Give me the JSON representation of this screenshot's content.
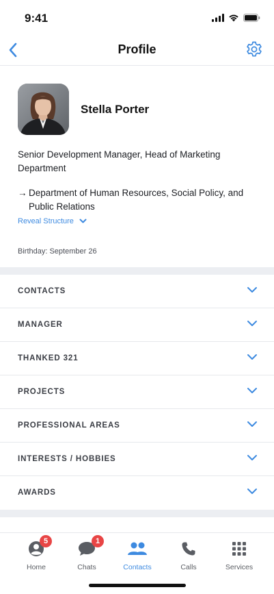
{
  "status_bar": {
    "time": "9:41",
    "icons": [
      "signal-icon",
      "wifi-icon",
      "battery-icon"
    ]
  },
  "nav": {
    "title": "Profile",
    "back_icon": "chevron-left-icon",
    "settings_icon": "gear-icon"
  },
  "profile": {
    "name": "Stella Porter",
    "position": "Senior Development Manager, Head of Marketing Department",
    "department_arrow": "→",
    "department": "Department of Human Resources, Social Policy, and Public Relations",
    "reveal_label": "Reveal Structure",
    "birthday": "Birthday: September 26"
  },
  "sections": [
    {
      "label": "CONTACTS"
    },
    {
      "label": "MANAGER"
    },
    {
      "label": "THANKED 321"
    },
    {
      "label": "PROJECTS"
    },
    {
      "label": "PROFESSIONAL AREAS"
    },
    {
      "label": "INTERESTS / HOBBIES"
    },
    {
      "label": "AWARDS"
    }
  ],
  "tabs": [
    {
      "label": "Home",
      "icon": "person-circle-icon",
      "badge": "5"
    },
    {
      "label": "Chats",
      "icon": "chat-bubble-icon",
      "badge": "1"
    },
    {
      "label": "Contacts",
      "icon": "people-icon",
      "badge": "",
      "active": true
    },
    {
      "label": "Calls",
      "icon": "phone-icon",
      "badge": ""
    },
    {
      "label": "Services",
      "icon": "grid-icon",
      "badge": ""
    }
  ],
  "colors": {
    "accent": "#3d8ae0",
    "badge": "#e84545",
    "divider": "#e6e8ec",
    "section_gap": "#eceef2"
  }
}
